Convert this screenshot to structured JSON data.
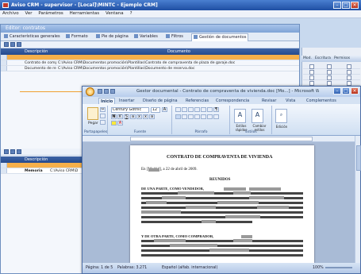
{
  "app": {
    "title": "Aviso CRM - supervisor - [Local]\\MINTC - Ejemplo CRM]",
    "menu": [
      "Archivo",
      "Ver",
      "Parámetros",
      "Herramientas",
      "Ventana",
      "?"
    ]
  },
  "editor": {
    "title": "Editor: contratos",
    "tabs": [
      "Características generales",
      "Formato",
      "Pie de página",
      "Variables",
      "Filtros",
      "Gestión de documentos"
    ],
    "top_grid": {
      "columns": [
        "Descripción",
        "Documento"
      ],
      "rows": [
        {
          "descripcion": "",
          "documento": ""
        },
        {
          "descripcion": "Contrato de comp",
          "documento": "C:\\Aviso CRM\\Documentos promoción\\Plantillas\\Contrato de compraventa de plaza de garaje.doc"
        },
        {
          "descripcion": "Documento de re",
          "documento": "C:\\Aviso CRM\\Documentos promoción\\Plantillas\\Documento de reserva.doc"
        }
      ]
    },
    "bottom_grid": {
      "columns": [
        "Descripción"
      ],
      "rows": [
        {
          "descripcion": "Memoria",
          "documento": "C:\\Aviso CRM\\D"
        }
      ]
    }
  },
  "side_strip": {
    "columns": [
      "Mod.",
      "Escritura",
      "Permisos"
    ]
  },
  "word": {
    "title": "Gestor documental - Contrato de compraventa de vivienda.doc [Mo...] - Microsoft Word",
    "ribbon_tabs": [
      "Inicio",
      "Insertar",
      "Diseño de página",
      "Referencias",
      "Correspondencia",
      "Revisar",
      "Vista",
      "Complementos"
    ],
    "clipboard_label": "Portapapeles",
    "paste_label": "Pegar",
    "font_name": "Century Gothic",
    "font_size": "12",
    "font_group_label": "Fuente",
    "paragraph_group_label": "Párrafo",
    "styles_group_label": "Estilos",
    "editing_group_label": "Edición",
    "style_quick": "Estilos rápidos",
    "style_change": "Cambiar estilos",
    "edit_label": "Edición",
    "document": {
      "heading": "CONTRATO DE COMPRAVENTA DE VIVIENDA",
      "place_date": "En [Madrid], a 22 de abril de 2009.",
      "section": "REUNIDOS",
      "para1_lead": "DE UNA PARTE, COMO VENDEDOR,",
      "para2_lead": "Y DE OTRA PARTE, COMO COMPRADOR,"
    },
    "status": {
      "page": "Página: 1 de 5",
      "words": "Palabras: 3.271",
      "language": "Español (alfab. internacional)",
      "zoom": "100%"
    }
  },
  "colors": {
    "titlebar": "#1f4fa3",
    "selected_row": "#f6b04a",
    "grid_header": "#254a8d"
  }
}
